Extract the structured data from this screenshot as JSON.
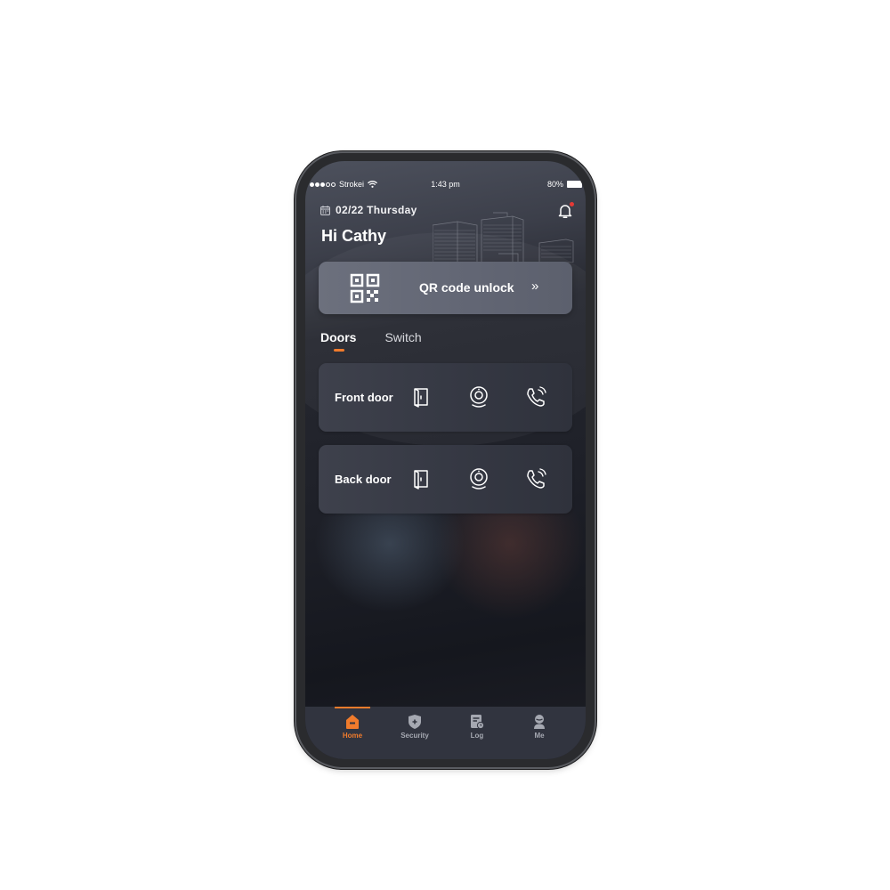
{
  "status_bar": {
    "carrier": "Strokei",
    "signal_bars_filled": 3,
    "signal_bars_total": 5,
    "time": "1:43 pm",
    "battery": "80%"
  },
  "header": {
    "date": "02/22 Thursday",
    "greeting": "Hi Cathy",
    "notification_badge": true
  },
  "qr_card": {
    "label": "QR code unlock",
    "chevron": "»"
  },
  "tabs": [
    {
      "label": "Doors",
      "active": true
    },
    {
      "label": "Switch",
      "active": false
    }
  ],
  "doors": [
    {
      "name": "Front door",
      "actions": [
        "door-unlock-icon",
        "camera-monitor-icon",
        "call-icon"
      ]
    },
    {
      "name": "Back door",
      "actions": [
        "door-unlock-icon",
        "camera-monitor-icon",
        "call-icon"
      ]
    }
  ],
  "bottom_nav": [
    {
      "label": "Home",
      "icon": "home-icon",
      "active": true
    },
    {
      "label": "Security",
      "icon": "shield-icon",
      "active": false
    },
    {
      "label": "Log",
      "icon": "log-icon",
      "active": false
    },
    {
      "label": "Me",
      "icon": "user-icon",
      "active": false
    }
  ],
  "colors": {
    "accent": "#f07b2c",
    "badge": "#e53935",
    "card": "#3a3d48",
    "tab_bar": "#31343f"
  }
}
